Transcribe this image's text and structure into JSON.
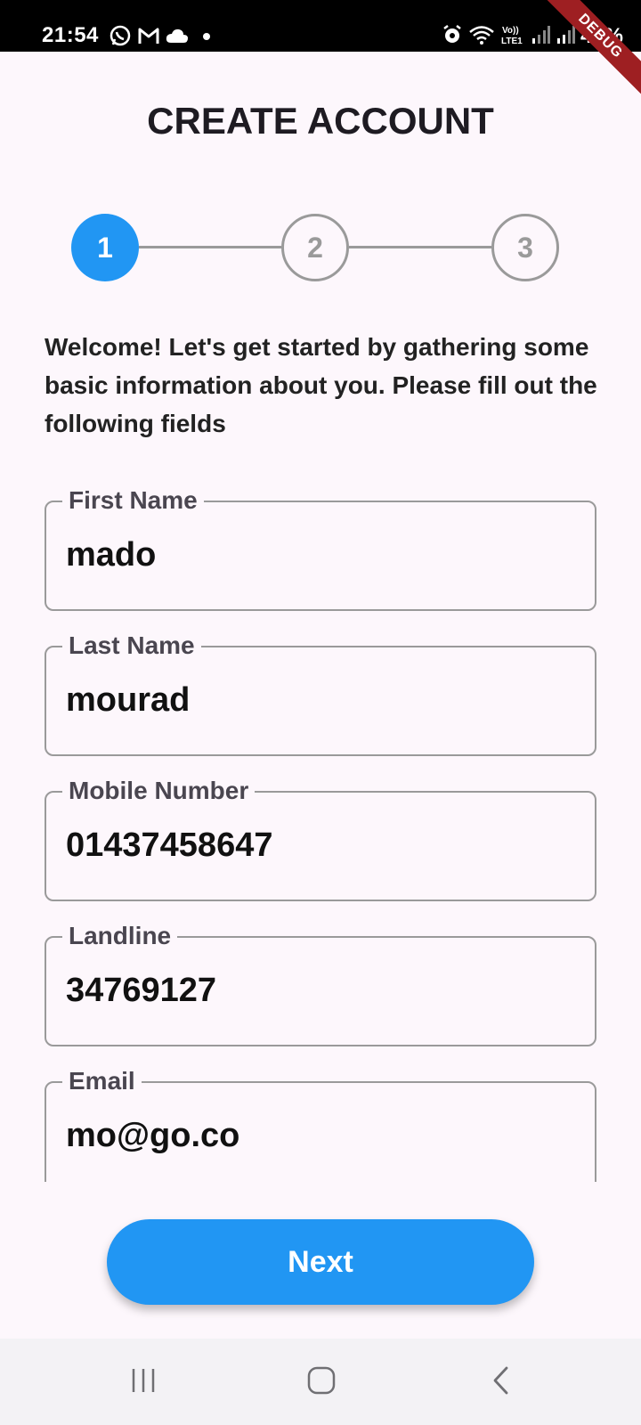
{
  "status_bar": {
    "time": "21:54",
    "battery": "46%",
    "debug_banner": "DEBUG",
    "left_icons": [
      "whatsapp-icon",
      "gmail-icon",
      "cloud-icon",
      "dot-icon"
    ],
    "right_icons": [
      "alarm-icon",
      "wifi-icon",
      "volte-icon",
      "signal-icon",
      "signal-icon"
    ]
  },
  "header": {
    "title": "CREATE ACCOUNT"
  },
  "stepper": {
    "steps": [
      "1",
      "2",
      "3"
    ],
    "active_step": 1,
    "active_color": "#2196f3",
    "inactive_color": "#9a9a9a"
  },
  "intro_text": "Welcome! Let's get started by gathering some basic information about you. Please fill out the following fields",
  "form": {
    "fields": [
      {
        "label": "First Name",
        "value": "mado"
      },
      {
        "label": "Last Name",
        "value": "mourad"
      },
      {
        "label": "Mobile Number",
        "value": "01437458647"
      },
      {
        "label": "Landline",
        "value": "34769127"
      },
      {
        "label": "Email",
        "value": "mo@go.co"
      }
    ]
  },
  "actions": {
    "next_label": "Next"
  },
  "nav_bar": {
    "buttons": [
      "recent-apps-icon",
      "home-icon",
      "back-icon"
    ]
  }
}
